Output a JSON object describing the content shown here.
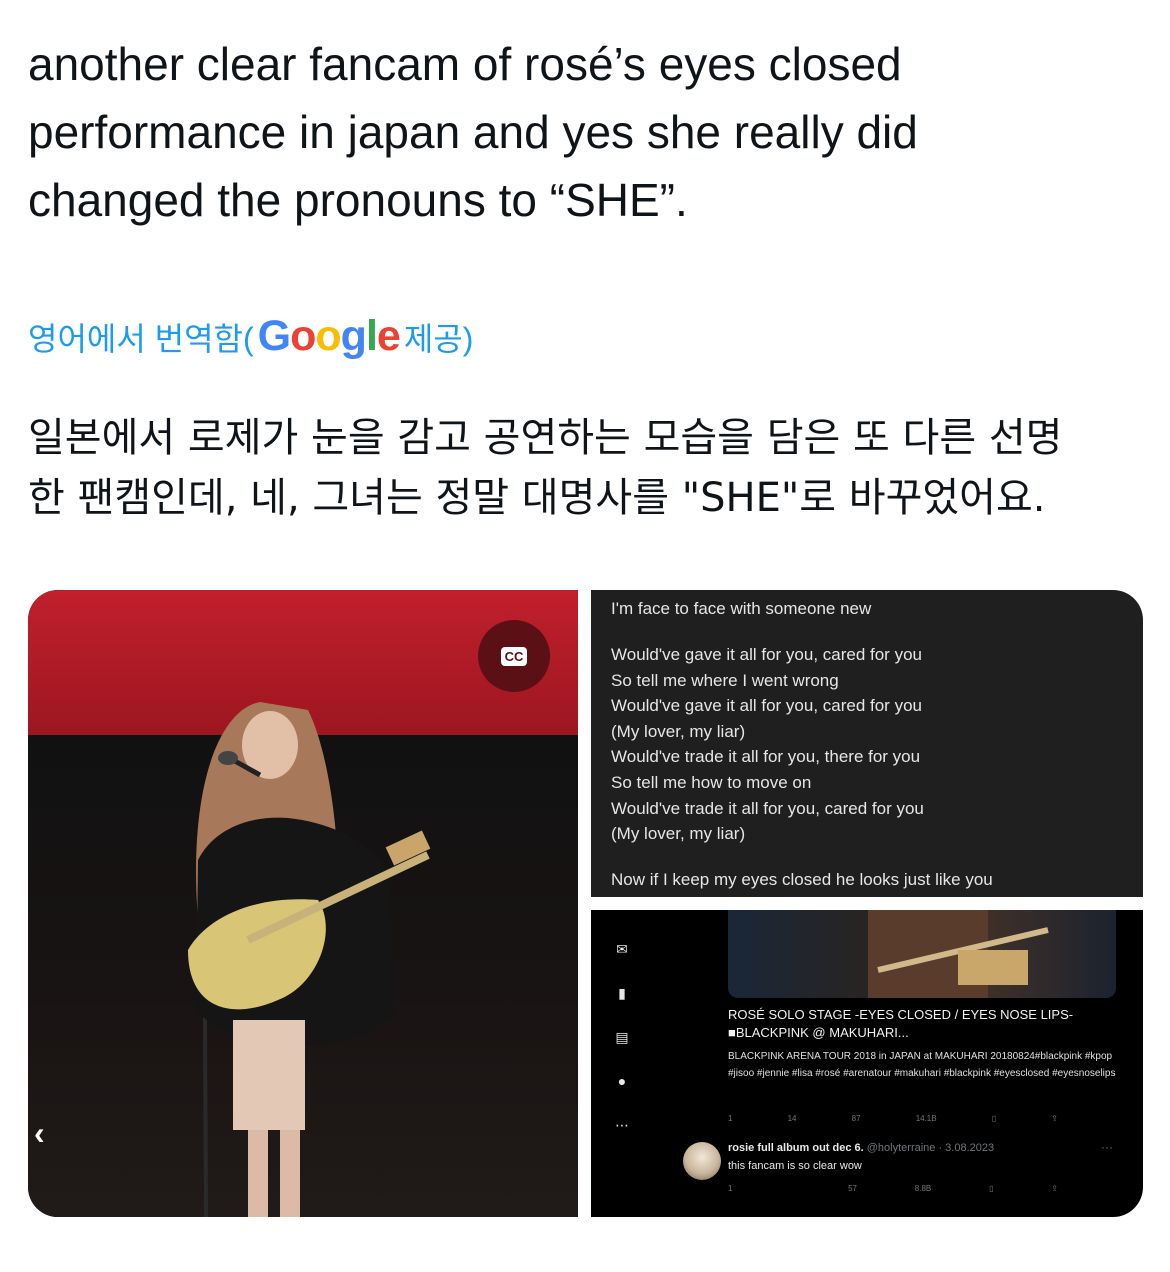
{
  "tweet": {
    "text_lines": [
      "another clear fancam of rosé’s eyes closed",
      "performance in japan and yes she really did",
      "changed the pronouns to “SHE”."
    ]
  },
  "translation": {
    "link_prefix": "영어에서 번역함(",
    "google": [
      "G",
      "o",
      "o",
      "g",
      "l",
      "e"
    ],
    "link_suffix": "제공)",
    "translated_lines": [
      "일본에서 로제가 눈을 감고 공연하는 모습을 담은 또 다른 선명",
      "한 팬캠인데, 네, 그녀는 정말 대명사를 \"SHE\"로 바꾸었어요."
    ]
  },
  "media": {
    "video": {
      "cc_label": "CC",
      "back_icon": "chevron-left-icon"
    },
    "lyrics": {
      "top_line": "I'm face to face with someone new",
      "verse": [
        "Would've gave it all for you, cared for you",
        "So tell me where I went wrong",
        "Would've gave it all for you, cared for you",
        "(My lover, my liar)",
        "Would've trade it all for you, there for you",
        "So tell me how to move on",
        "Would've trade it all for you, cared for you",
        "(My lover, my liar)"
      ],
      "bottom_line": "Now if I keep my eyes closed he looks just like you"
    },
    "screenshot": {
      "side_icons": [
        "mail-icon",
        "bookmark-icon",
        "list-icon",
        "avatar-icon",
        "more-icon"
      ],
      "video_title": "ROSÉ SOLO STAGE -EYES CLOSED / EYES NOSE LIPS- ■BLACKPINK @ MAKUHARI...",
      "video_desc": "BLACKPINK ARENA TOUR 2018 in JAPAN at MAKUHARI 20180824#blackpink #kpop #jisoo #jennie #lisa #rosé #arenatour #makuhari #blackpink #eyesclosed #eyesnoselips",
      "stats1": [
        "1",
        "14",
        "87",
        "14.1B"
      ],
      "stats2": [
        "1",
        "",
        "57",
        "8.8B"
      ],
      "reply": {
        "name": "rosie full album out dec 6.",
        "handle": "@holyterraine · 3.08.2023",
        "text": "this fancam is so clear wow"
      }
    }
  }
}
